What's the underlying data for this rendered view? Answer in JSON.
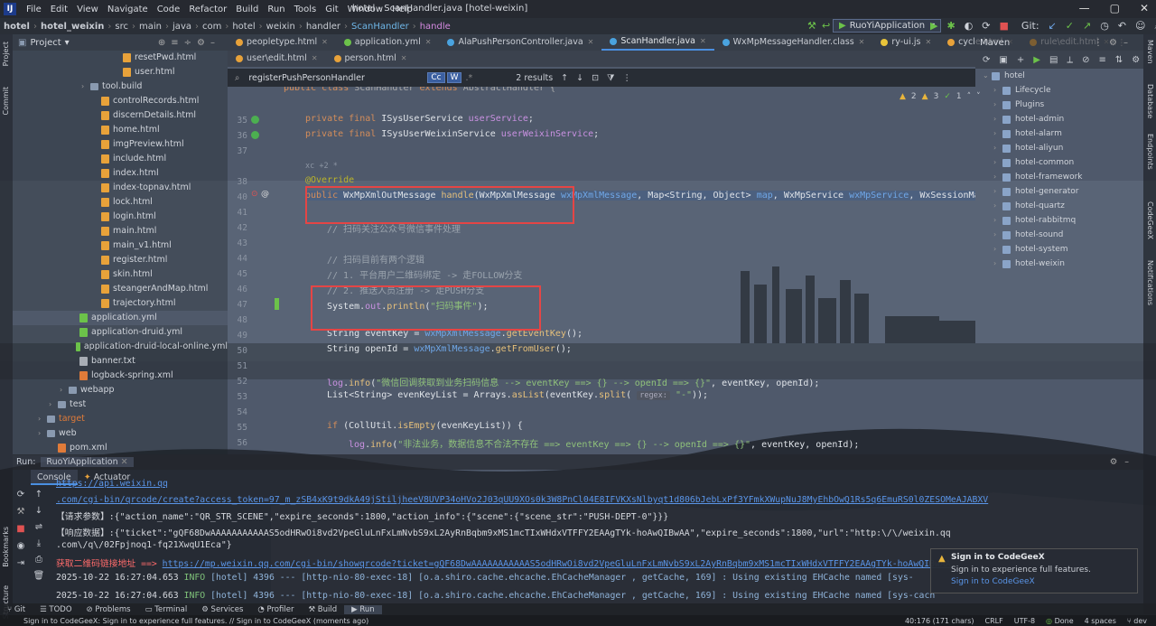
{
  "menubar": {
    "logo": "IJ",
    "items": [
      "File",
      "Edit",
      "View",
      "Navigate",
      "Code",
      "Refactor",
      "Build",
      "Run",
      "Tools",
      "Git",
      "Window",
      "Help"
    ],
    "window_title": "hotel - ScanHandler.java [hotel-weixin]",
    "controls": [
      "—",
      "▢",
      "✕"
    ]
  },
  "breadcrumb": [
    "hotel",
    "hotel_weixin",
    "src",
    "main",
    "java",
    "com",
    "hotel",
    "weixin",
    "handler",
    "ScanHandler",
    "handle"
  ],
  "toolbar": {
    "run_config": "RuoYiApplication",
    "git_label": "Git:"
  },
  "left_strip": [
    "Project",
    "Commit",
    "Bookmarks",
    "Structure"
  ],
  "right_strip": [
    "Maven",
    "Database",
    "Endpoints",
    "CodeGeeX",
    "Notifications"
  ],
  "project_panel": {
    "title": "Project",
    "rows": [
      {
        "indent": 9,
        "icon": "html",
        "name": "resetPwd.html"
      },
      {
        "indent": 9,
        "icon": "html",
        "name": "user.html"
      },
      {
        "indent": 6,
        "icon": "fold",
        "arrow": "›",
        "name": "tool.build"
      },
      {
        "indent": 7,
        "icon": "html",
        "name": "controlRecords.html"
      },
      {
        "indent": 7,
        "icon": "html",
        "name": "discernDetails.html"
      },
      {
        "indent": 7,
        "icon": "html",
        "name": "home.html"
      },
      {
        "indent": 7,
        "icon": "html",
        "name": "imgPreview.html"
      },
      {
        "indent": 7,
        "icon": "html",
        "name": "include.html"
      },
      {
        "indent": 7,
        "icon": "html",
        "name": "index.html"
      },
      {
        "indent": 7,
        "icon": "html",
        "name": "index-topnav.html"
      },
      {
        "indent": 7,
        "icon": "html",
        "name": "lock.html"
      },
      {
        "indent": 7,
        "icon": "html",
        "name": "login.html"
      },
      {
        "indent": 7,
        "icon": "html",
        "name": "main.html"
      },
      {
        "indent": 7,
        "icon": "html",
        "name": "main_v1.html"
      },
      {
        "indent": 7,
        "icon": "html",
        "name": "register.html"
      },
      {
        "indent": 7,
        "icon": "html",
        "name": "skin.html"
      },
      {
        "indent": 7,
        "icon": "html",
        "name": "steangerAndMap.html"
      },
      {
        "indent": 7,
        "icon": "html",
        "name": "trajectory.html"
      },
      {
        "indent": 5,
        "icon": "yml",
        "name": "application.yml",
        "selected": true
      },
      {
        "indent": 5,
        "icon": "yml",
        "name": "application-druid.yml"
      },
      {
        "indent": 5,
        "icon": "yml",
        "name": "application-druid-local-online.yml"
      },
      {
        "indent": 5,
        "icon": "txt",
        "name": "banner.txt"
      },
      {
        "indent": 5,
        "icon": "xml",
        "name": "logback-spring.xml"
      },
      {
        "indent": 4,
        "icon": "fold",
        "arrow": "›",
        "name": "webapp"
      },
      {
        "indent": 3,
        "icon": "fold",
        "arrow": "›",
        "name": "test"
      },
      {
        "indent": 2,
        "icon": "fold",
        "arrow": "›",
        "name": "target",
        "color": "#e07b39"
      },
      {
        "indent": 2,
        "icon": "fold",
        "arrow": "›",
        "name": "web"
      },
      {
        "indent": 3,
        "icon": "xml",
        "name": "pom.xml"
      }
    ]
  },
  "tabs_row1": [
    {
      "label": "peopletype.html",
      "color": "#e8a23a"
    },
    {
      "label": "application.yml",
      "color": "#6cc24a"
    },
    {
      "label": "AlaPushPersonController.java",
      "color": "#4aa3df"
    },
    {
      "label": "ScanHandler.java",
      "color": "#4aa3df",
      "active": true
    },
    {
      "label": "WxMpMessageHandler.class",
      "color": "#4aa3df"
    },
    {
      "label": "ry-ui.js",
      "color": "#e8c43a"
    },
    {
      "label": "cycle.html",
      "color": "#e8a23a"
    },
    {
      "label": "rule\\edit.html",
      "color": "#e8a23a"
    }
  ],
  "tabs_row2": [
    {
      "label": "user\\edit.html",
      "color": "#e8a23a"
    },
    {
      "label": "person.html",
      "color": "#e8a23a"
    }
  ],
  "findbar": {
    "query": "registerPushPersonHandler",
    "opt1": "Cc",
    "opt2": "W",
    "results": "2 results"
  },
  "editor": {
    "inspections": {
      "warnings": "2",
      "weak": "3",
      "ok": "1"
    },
    "author_hint": "xc +2 *",
    "regex_hint": "regex:",
    "lines": [
      {
        "n": "",
        "t": "public class ScanHandler extends AbstractHandler {"
      },
      {
        "n": "35",
        "t": "private final ISysUserService userService;"
      },
      {
        "n": "36",
        "t": "private final ISysUserWeixinService userWeixinService;"
      },
      {
        "n": "37",
        "t": ""
      },
      {
        "n": "38",
        "t": "@Override"
      },
      {
        "n": "40",
        "t": "public WxMpXmlOutMessage handle(WxMpXmlMessage wxMpXmlMessage, Map<String, Object> map, WxMpService wxMpService, WxSessionMa"
      },
      {
        "n": "41",
        "t": ""
      },
      {
        "n": "42",
        "t": "// 扫码关注公众号微信事件处理"
      },
      {
        "n": "43",
        "t": ""
      },
      {
        "n": "44",
        "t": "// 扫码目前有两个逻辑"
      },
      {
        "n": "45",
        "t": "// 1. 平台用户二维码绑定 -> 走FOLLOW分支"
      },
      {
        "n": "46",
        "t": "// 2. 推送人员注册 -> 走PUSH分支"
      },
      {
        "n": "47",
        "t": "System.out.println(\"扫码事件\");"
      },
      {
        "n": "48",
        "t": ""
      },
      {
        "n": "49",
        "t": "String eventKey = wxMpXmlMessage.getEventKey();"
      },
      {
        "n": "50",
        "t": "String openId = wxMpXmlMessage.getFromUser();"
      },
      {
        "n": "51",
        "t": ""
      },
      {
        "n": "52",
        "t": "log.info(\"微信回调获取到业务扫码信息 --> eventKey ==> {} --> openId ==> {}\", eventKey, openId);"
      },
      {
        "n": "53",
        "t": "List<String> evenKeyList = Arrays.asList(eventKey.split( \"-\"));"
      },
      {
        "n": "54",
        "t": ""
      },
      {
        "n": "55",
        "t": "if (CollUtil.isEmpty(evenKeyList)) {"
      },
      {
        "n": "56",
        "t": "log.info(\"非法业务，数据信息不合法不存在 ==> eventKey ==> {} --> openId ==> {}\", eventKey, openId);"
      }
    ]
  },
  "maven": {
    "title": "Maven",
    "root": "hotel",
    "items": [
      "Lifecycle",
      "Plugins",
      "hotel-admin",
      "hotel-alarm",
      "hotel-aliyun",
      "hotel-common",
      "hotel-framework",
      "hotel-generator",
      "hotel-quartz",
      "hotel-rabbitmq",
      "hotel-sound",
      "hotel-system",
      "hotel-weixin"
    ]
  },
  "run_panel": {
    "label": "Run:",
    "config": "RuoYiApplication",
    "tabs": [
      "Console",
      "Actuator"
    ],
    "console": [
      {
        "cls": "link",
        "t": "  https://api.weixin.qq"
      },
      {
        "cls": "link",
        "t": ".com/cgi-bin/qrcode/create?access_token=97_m_zSB4xK9t9dkA49jStiljheeV8UVP34oHVo2J03qUU9XOs0k3W8PnCl04E8IFVKXsNlbyqt1d806bJebLxPf3YFmkXWupNuJ8MyEhbOwQ1Rs5q6EmuRS0l0ZESOMeAJABXV"
      },
      {
        "cls": "cstr",
        "t": "【请求参数】:{\"action_name\":\"QR_STR_SCENE\",\"expire_seconds\":1800,\"action_info\":{\"scene\":{\"scene_str\":\"PUSH-DEPT-0\"}}}"
      },
      {
        "cls": "cstr",
        "t": "【响应数据】:{\"ticket\":\"gQF68DwAAAAAAAAAAAS5odHRwOi8vd2VpeGluLnFxLmNvbS9xL2AyRnBqbm9xMS1mcTIxWHdxVTFFY2EAAgTYk-hoAwQIBwAA\",\"expire_seconds\":1800,\"url\":\"http:\\/\\/weixin.qq"
      },
      {
        "cls": "cstr",
        "t": ".com\\/q\\/02Fpjnoq1-fq21XwqU1Eca\"}"
      },
      {
        "cls": "mix",
        "a": "获取二维码链接地址 ==> ",
        "b": "https://mp.weixin.qq.com/cgi-bin/showqrcode?ticket=gQF68DwAAAAAAAAAAAS5odHRwOi8vd2VpeGluLnFxLmNvbS9xL2AyRnBqbm9xMS1mcTIxWHdxVTFFY2EAAgTYk-hoAwQIBwAA"
      },
      {
        "cls": "log",
        "time": "2025-10-22 16:27:04.653",
        "lvl": "INFO",
        "mod": "[hotel] 4396 --- [http-nio-80-exec-18] [o.a.shiro.cache.ehcache.EhCacheManager  , getCache, 169] : Using existing EHCache named [sys-"
      },
      {
        "cls": "log",
        "time": "2025-10-22 16:27:04.663",
        "lvl": "INFO",
        "mod": "[hotel] 4396 --- [http-nio-80-exec-18] [o.a.shiro.cache.ehcache.EhCacheManager  , getCache, 169] : Using existing EHCache named [sys-cach"
      }
    ]
  },
  "notification": {
    "title": "Sign in to CodeGeeX",
    "body": "Sign in to experience full features.",
    "link": "Sign in to CodeGeeX"
  },
  "bottom_tools": [
    "Git",
    "TODO",
    "Problems",
    "Terminal",
    "Services",
    "Profiler",
    "Build",
    "Run"
  ],
  "status": {
    "message": "Sign in to CodeGeeX: Sign in to experience full features. // Sign in to CodeGeeX (moments ago)",
    "position": "40:176 (171 chars)",
    "line_sep": "CRLF",
    "encoding": "UTF-8",
    "done": "Done",
    "indent": "4 spaces",
    "branch": "dev"
  }
}
